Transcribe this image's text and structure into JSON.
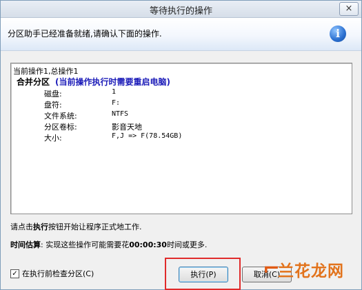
{
  "window": {
    "title": "等待执行的操作",
    "close_label": "×"
  },
  "header": {
    "text": "分区助手已经准备就绪,请确认下面的操作.",
    "icon": "info-icon",
    "icon_glyph": "i"
  },
  "operations": {
    "summary": "当前操作1,总操作1",
    "title": "合并分区",
    "warning": "(当前操作执行时需要重启电脑)",
    "details": [
      {
        "key": "磁盘:",
        "value": "1"
      },
      {
        "key": "盘符:",
        "value": "F:"
      },
      {
        "key": "文件系统:",
        "value": "NTFS"
      },
      {
        "key": "分区卷标:",
        "value": "影音天地"
      },
      {
        "key": "大小:",
        "value": "F,J => F(78.54GB)"
      }
    ]
  },
  "notes": {
    "line1_prefix": "请点击",
    "line1_bold": "执行",
    "line1_suffix": "按钮开始让程序正式地工作.",
    "line2_bold": "时间估算",
    "line2_prefix": ": 实现这些操作可能需要花",
    "line2_time": "00:00:30",
    "line2_suffix": "时间或更多."
  },
  "footer": {
    "checkbox_label": "在执行前检查分区(C)",
    "checkbox_checked": "✓",
    "exec_button": "执行(P)",
    "cancel_button": "取消(C)"
  },
  "watermark": {
    "mark": "⌐",
    "text": "兰花龙网"
  }
}
